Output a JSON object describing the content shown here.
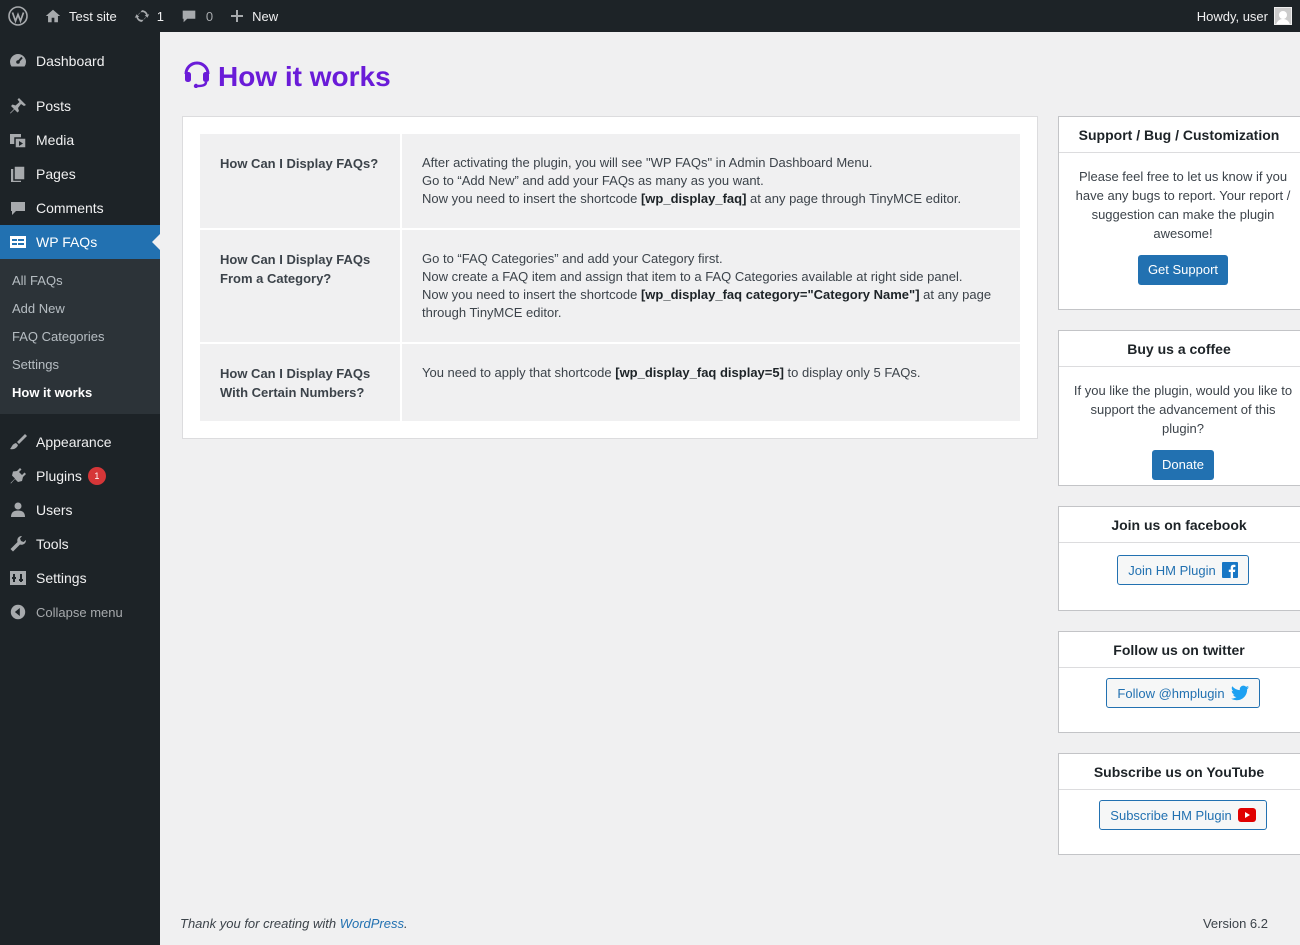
{
  "adminbar": {
    "site_name": "Test site",
    "updates_count": "1",
    "comments_count": "0",
    "new_label": "New",
    "greeting": "Howdy, user"
  },
  "sidebar": {
    "items": [
      {
        "label": "Dashboard",
        "icon": "dashboard-icon"
      },
      {
        "label": "Posts",
        "icon": "pin-icon"
      },
      {
        "label": "Media",
        "icon": "media-icon"
      },
      {
        "label": "Pages",
        "icon": "pages-icon"
      },
      {
        "label": "Comments",
        "icon": "comment-icon"
      },
      {
        "label": "WP FAQs",
        "icon": "faq-icon"
      }
    ],
    "submenu": [
      "All FAQs",
      "Add New",
      "FAQ Categories",
      "Settings",
      "How it works"
    ],
    "items_bottom": [
      {
        "label": "Appearance",
        "icon": "brush-icon"
      },
      {
        "label": "Plugins",
        "icon": "plugin-icon",
        "badge": "1"
      },
      {
        "label": "Users",
        "icon": "users-icon"
      },
      {
        "label": "Tools",
        "icon": "wrench-icon"
      },
      {
        "label": "Settings",
        "icon": "settings-icon"
      }
    ],
    "collapse_label": "Collapse menu"
  },
  "page": {
    "title": "How it works",
    "accent_color": "#6a1bd8"
  },
  "faqs": [
    {
      "question": "How Can I Display FAQs?",
      "lines": [
        {
          "pre": "After activating the plugin, you will see \"WP FAQs\" in Admin Dashboard Menu.",
          "code": "",
          "post": ""
        },
        {
          "pre": "Go to “Add New” and add your FAQs as many as you want.",
          "code": "",
          "post": ""
        },
        {
          "pre": "Now you need to insert the shortcode ",
          "code": "[wp_display_faq]",
          "post": " at any page through TinyMCE editor."
        }
      ]
    },
    {
      "question": "How Can I Display FAQs From a Category?",
      "lines": [
        {
          "pre": "Go to “FAQ Categories” and add your Category first.",
          "code": "",
          "post": ""
        },
        {
          "pre": "Now create a FAQ item and assign that item to a FAQ Categories available at right side panel.",
          "code": "",
          "post": ""
        },
        {
          "pre": "Now you need to insert the shortcode ",
          "code": "[wp_display_faq category=\"Category Name\"]",
          "post": " at any page through TinyMCE editor."
        }
      ]
    },
    {
      "question": "How Can I Display FAQs With Certain Numbers?",
      "lines": [
        {
          "pre": "You need to apply that shortcode ",
          "code": "[wp_display_faq display=5]",
          "post": " to display only 5 FAQs."
        }
      ]
    }
  ],
  "widgets": {
    "support": {
      "title": "Support / Bug / Customization",
      "text": "Please feel free to let us know if you have any bugs to report. Your report / suggestion can make the plugin awesome!",
      "button": "Get Support"
    },
    "coffee": {
      "title": "Buy us a coffee",
      "text": "If you like the plugin, would you like to support the advancement of this plugin?",
      "button": "Donate"
    },
    "facebook": {
      "title": "Join us on facebook",
      "button": "Join HM Plugin",
      "icon_color": "#3b5998"
    },
    "twitter": {
      "title": "Follow us on twitter",
      "button": "Follow @hmplugin",
      "icon_color": "#1da1f2"
    },
    "youtube": {
      "title": "Subscribe us on YouTube",
      "button": "Subscribe HM Plugin",
      "icon_color": "#e00000"
    }
  },
  "footer": {
    "text_pre": "Thank you for creating with ",
    "link": "WordPress",
    "text_post": ".",
    "version": "Version 6.2"
  }
}
